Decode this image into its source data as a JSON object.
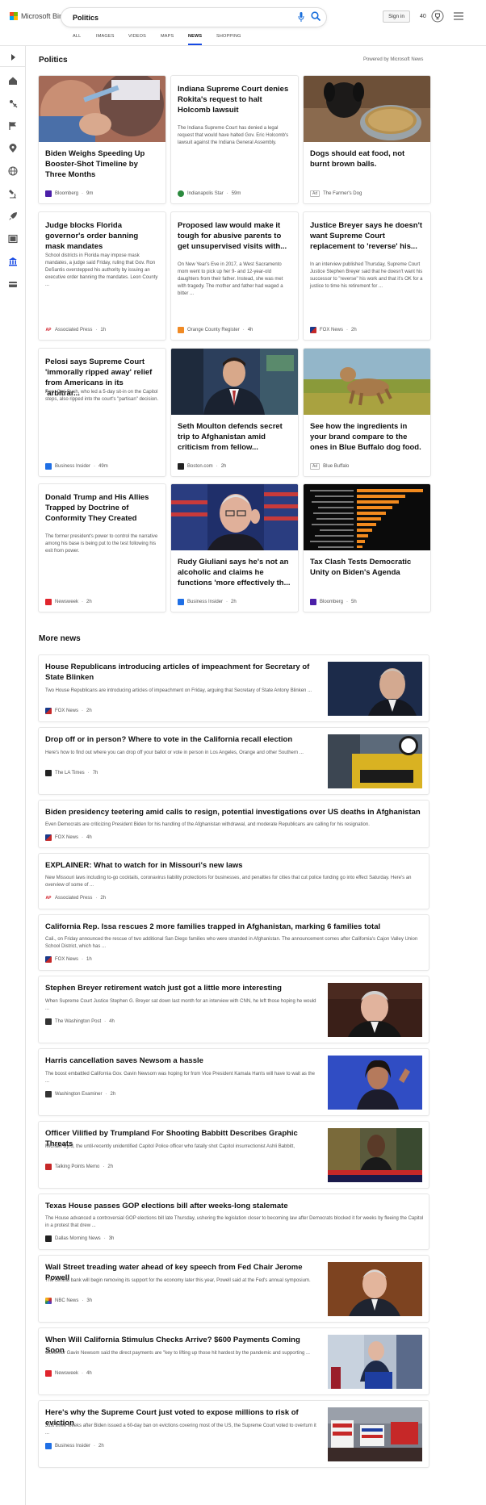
{
  "header": {
    "logo_text": "Microsoft Bing",
    "search_value": "Politics",
    "signin_label": "Sign in",
    "rewards_count": "40",
    "tabs": [
      "ALL",
      "IMAGES",
      "VIDEOS",
      "MAPS",
      "NEWS",
      "SHOPPING"
    ],
    "active_tab": "NEWS"
  },
  "rail": {
    "icons": [
      "expand-icon",
      "home-icon",
      "sports-icon",
      "flag-icon",
      "location-icon",
      "globe-icon",
      "science-icon",
      "rocket-icon",
      "entertainment-icon",
      "politics-icon",
      "money-icon"
    ]
  },
  "main": {
    "section_title": "Politics",
    "powered_by": "Powered by Microsoft News",
    "cards": [
      {
        "title": "Biden Weighs Speeding Up Booster-Shot Timeline by Three Months",
        "snippet": "",
        "source": "Bloomberg",
        "time": "9m",
        "ad": false,
        "logo_color": "#4b1fa8",
        "image": "vaccine"
      },
      {
        "title": "Indiana Supreme Court denies Rokita's request to halt Holcomb lawsuit",
        "snippet": "The Indiana Supreme Court has denied a legal request that would have halted Gov. Eric Holcomb's lawsuit against the Indiana General Assembly.",
        "source": "Indianapolis Star",
        "time": "59m",
        "ad": false,
        "logo_color": "#2b8a3e",
        "image": ""
      },
      {
        "title": "Dogs should eat food, not burnt brown balls.",
        "snippet": "",
        "source": "The Farmer's Dog",
        "time": "",
        "ad": true,
        "ad_label": "Ad",
        "logo_color": "",
        "image": "dog-bowl"
      },
      {
        "title": "Judge blocks Florida governor's order banning mask mandates",
        "snippet": "School districts in Florida may impose mask mandates, a judge said Friday, ruling that Gov. Ron DeSantis overstepped his authority by issuing an executive order banning the mandates. Leon County ...",
        "source": "Associated Press",
        "time": "1h",
        "ad": false,
        "logo_color": "#d11f2a",
        "image": ""
      },
      {
        "title": "Proposed law would make it tough for abusive parents to get unsupervised visits with...",
        "snippet": "On New Year's Eve in 2017, a West Sacramento mom went to pick up her 9- and 12-year-old daughters from their father. Instead, she was met with tragedy. The mother and father had waged a bitter ...",
        "source": "Orange County Register",
        "time": "4h",
        "ad": false,
        "logo_color": "#f08a24",
        "image": ""
      },
      {
        "title": "Justice Breyer says he doesn't want Supreme Court replacement to 'reverse' his...",
        "snippet": "In an interview published Thursday, Supreme Court Justice Stephen Breyer said that he doesn't want his successor to \"reverse\" his work and that it's OK for a justice to time his retirement for ...",
        "source": "FOX News",
        "time": "2h",
        "ad": false,
        "logo_color": "#1a3a8a",
        "image": ""
      },
      {
        "title": "Pelosi says Supreme Court 'immorally ripped away' relief from Americans in its 'arbitrar...",
        "snippet": "Rep. Cori Bush, who led a 5-day sit-in on the Capitol steps, also ripped into the court's \"partisan\" decision.",
        "source": "Business Insider",
        "time": "49m",
        "ad": false,
        "logo_color": "#1f6fe5",
        "image": ""
      },
      {
        "title": "Seth Moulton defends secret trip to Afghanistan amid criticism from fellow...",
        "snippet": "",
        "source": "Boston.com",
        "time": "2h",
        "ad": false,
        "logo_color": "#222222",
        "image": "tv-studio"
      },
      {
        "title": "See how the ingredients in your brand compare to the ones in Blue Buffalo dog food.",
        "snippet": "",
        "source": "Blue Buffalo",
        "time": "",
        "ad": true,
        "ad_label": "Ad",
        "logo_color": "",
        "image": "running-dog"
      },
      {
        "title": "Donald Trump and His Allies Trapped by Doctrine of Conformity They Created",
        "snippet": "The former president's power to control the narrative among his base is being put to the test following his exit from power.",
        "source": "Newsweek",
        "time": "2h",
        "ad": false,
        "logo_color": "#e0252d",
        "image": ""
      },
      {
        "title": "Rudy Giuliani says he's not an alcoholic and claims he functions 'more effectively th...",
        "snippet": "",
        "source": "Business Insider",
        "time": "2h",
        "ad": false,
        "logo_color": "#1f6fe5",
        "image": "flag-portrait"
      },
      {
        "title": "Tax Clash Tests Democratic Unity on Biden's Agenda",
        "snippet": "",
        "source": "Bloomberg",
        "time": "5h",
        "ad": false,
        "logo_color": "#4b1fa8",
        "image": "bar-graphic"
      }
    ]
  },
  "more_news": {
    "title": "More news",
    "items": [
      {
        "title": "House Republicans introducing articles of impeachment for Secretary of State Blinken",
        "snippet": "Two House Republicans are introducing articles of impeachment on Friday, arguing that Secretary of State Antony Blinken ...",
        "source": "FOX News",
        "time": "2h",
        "logo_color": "#1a3a8a",
        "image": "man-dark"
      },
      {
        "title": "Drop off or in person? Where to vote in the California recall election",
        "snippet": "Here's how to find out where you can drop off your ballot or vote in person in Los Angeles, Orange and other Southern ...",
        "source": "The LA Times",
        "time": "7h",
        "logo_color": "#222222",
        "image": "ballot-box"
      },
      {
        "title": "Biden presidency teetering amid calls to resign, potential investigations over US deaths in Afghanistan",
        "snippet": "Even Democrats are criticizing President Biden for his handling of the Afghanistan withdrawal, and moderate Republicans are calling for his resignation.",
        "source": "FOX News",
        "time": "4h",
        "logo_color": "#1a3a8a",
        "image": ""
      },
      {
        "title": "EXPLAINER: What to watch for in Missouri's new laws",
        "snippet": "New Missouri laws including to-go cocktails, coronavirus liability protections for businesses, and penalties for cities that cut police funding go into effect Saturday. Here's an overview of some of ...",
        "source": "Associated Press",
        "time": "2h",
        "logo_color": "#d11f2a",
        "image": ""
      },
      {
        "title": "California Rep. Issa rescues 2 more families trapped in Afghanistan, marking 6 families total",
        "snippet": "Cali., on Friday announced the rescue of two additional San Diego families who were stranded in Afghanistan. The announcement comes after California's Cajon Valley Union School District, which has ...",
        "source": "FOX News",
        "time": "1h",
        "logo_color": "#1a3a8a",
        "image": ""
      },
      {
        "title": "Stephen Breyer retirement watch just got a little more interesting",
        "snippet": "When Supreme Court Justice Stephen G. Breyer sat down last month for an interview with CNN, he left those hoping he would ...",
        "source": "The Washington Post",
        "time": "4h",
        "logo_color": "#333333",
        "image": "older-man"
      },
      {
        "title": "Harris cancellation saves Newsom a hassle",
        "snippet": "The boost embattled California Gov. Gavin Newsom was hoping for from Vice President Kamala Harris will have to wait as the ...",
        "source": "Washington Examiner",
        "time": "2h",
        "logo_color": "#333333",
        "image": "woman-blue"
      },
      {
        "title": "Officer Vilified by Trumpland For Shooting Babbitt Describes Graphic Threats",
        "snippet": "Michael Byrd, the until-recently unidentified Capitol Police officer who fatally shot Capitol insurrectionist Ashli Babbitt,",
        "source": "Talking Points Memo",
        "time": "2h",
        "logo_color": "#c62828",
        "image": "tv-news"
      },
      {
        "title": "Texas House passes GOP elections bill after weeks-long stalemate",
        "snippet": "The House advanced a controversial GOP elections bill late Thursday, ushering the legislation closer to becoming law after Democrats blocked it for weeks by fleeing the Capitol in a protest that drew ...",
        "source": "Dallas Morning News",
        "time": "3h",
        "logo_color": "#222222",
        "image": ""
      },
      {
        "title": "Wall Street treading water ahead of key speech from Fed Chair Jerome Powell",
        "snippet": "The central bank will begin removing its support for the economy later this year, Powell said at the Fed's annual symposium.",
        "source": "NBC News",
        "time": "3h",
        "logo_color": "#333333",
        "image": "speaker-brown"
      },
      {
        "title": "When Will California Stimulus Checks Arrive? $600 Payments Coming Soon",
        "snippet": "Governor Gavin Newsom said the direct payments are \"key to lifting up those hit hardest by the pandemic and supporting ...",
        "source": "Newsweek",
        "time": "4h",
        "logo_color": "#e0252d",
        "image": "podium"
      },
      {
        "title": "Here's why the Supreme Court just voted to expose millions to risk of eviction",
        "snippet": "Just three weeks after Biden issued a 60-day ban on evictions covering most of the US, the Supreme Court voted to overturn it ...",
        "source": "Business Insider",
        "time": "2h",
        "logo_color": "#1f6fe5",
        "image": "protest"
      }
    ]
  },
  "colors": {
    "accent": "#174ae4",
    "search_icon": "#1a6fdc"
  }
}
